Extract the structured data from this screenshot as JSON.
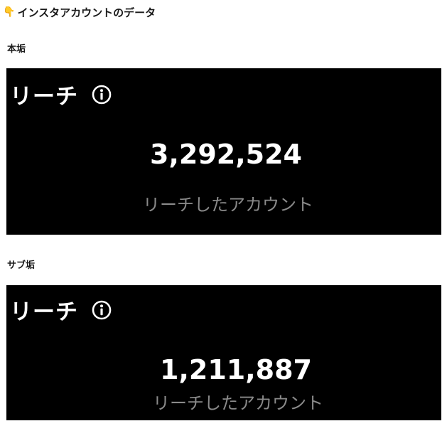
{
  "heading": {
    "emoji": "👇",
    "text": "インスタアカウントのデータ"
  },
  "sections": [
    {
      "label": "本垢",
      "card": {
        "title": "リーチ",
        "info_icon": "info-circle-icon",
        "reach_value": "3,292,524",
        "reach_caption": "リーチしたアカウント"
      }
    },
    {
      "label": "サブ垢",
      "card": {
        "title": "リーチ",
        "info_icon": "info-circle-icon",
        "reach_value": "1,211,887",
        "reach_caption": "リーチしたアカウント"
      }
    }
  ],
  "colors": {
    "card_background": "#000000",
    "card_text": "#ffffff",
    "caption_text": "#8a8a8a",
    "page_background": "#ffffff"
  }
}
